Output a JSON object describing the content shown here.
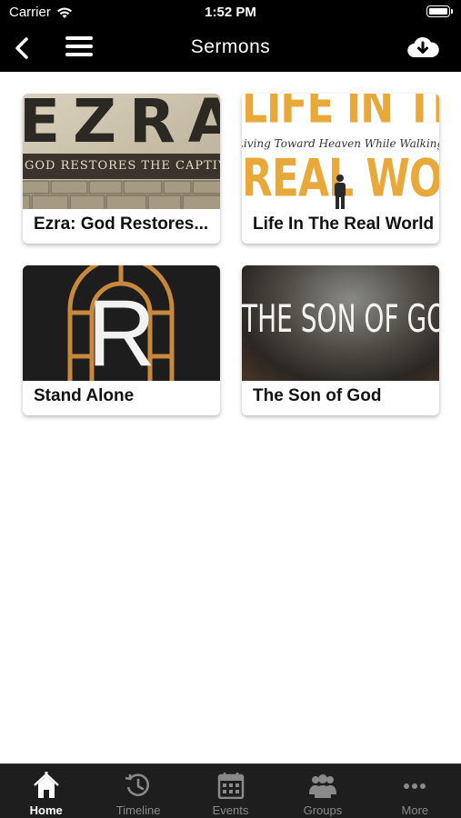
{
  "status_bar": {
    "carrier": "Carrier",
    "time": "1:52 PM"
  },
  "nav": {
    "title": "Sermons"
  },
  "sermons": [
    {
      "label": "Ezra: God Restores...",
      "art_word": "EZRA",
      "art_sub": "GOD RESTORES THE CAPTIVE"
    },
    {
      "label": "Life In The Real World",
      "art_word_top": "LIFE IN THE",
      "art_word_bottom": "REAL WORLD",
      "art_script": "Living Toward Heaven While Walking on Earth"
    },
    {
      "label": "Stand Alone",
      "art_word": "R"
    },
    {
      "label": "The Son of God",
      "art_word": "THE SON OF GOD"
    }
  ],
  "tabs": [
    {
      "label": "Home",
      "icon": "home-icon",
      "active": true
    },
    {
      "label": "Timeline",
      "icon": "timeline-icon",
      "active": false
    },
    {
      "label": "Events",
      "icon": "calendar-icon",
      "active": false
    },
    {
      "label": "Groups",
      "icon": "groups-icon",
      "active": false
    },
    {
      "label": "More",
      "icon": "more-icon",
      "active": false
    }
  ],
  "colors": {
    "bar_background": "#000000",
    "tab_background": "#1e1e1e",
    "tab_active": "#ffffff",
    "tab_inactive": "#8a8a8a",
    "accent_gold": "#e8a93a"
  }
}
